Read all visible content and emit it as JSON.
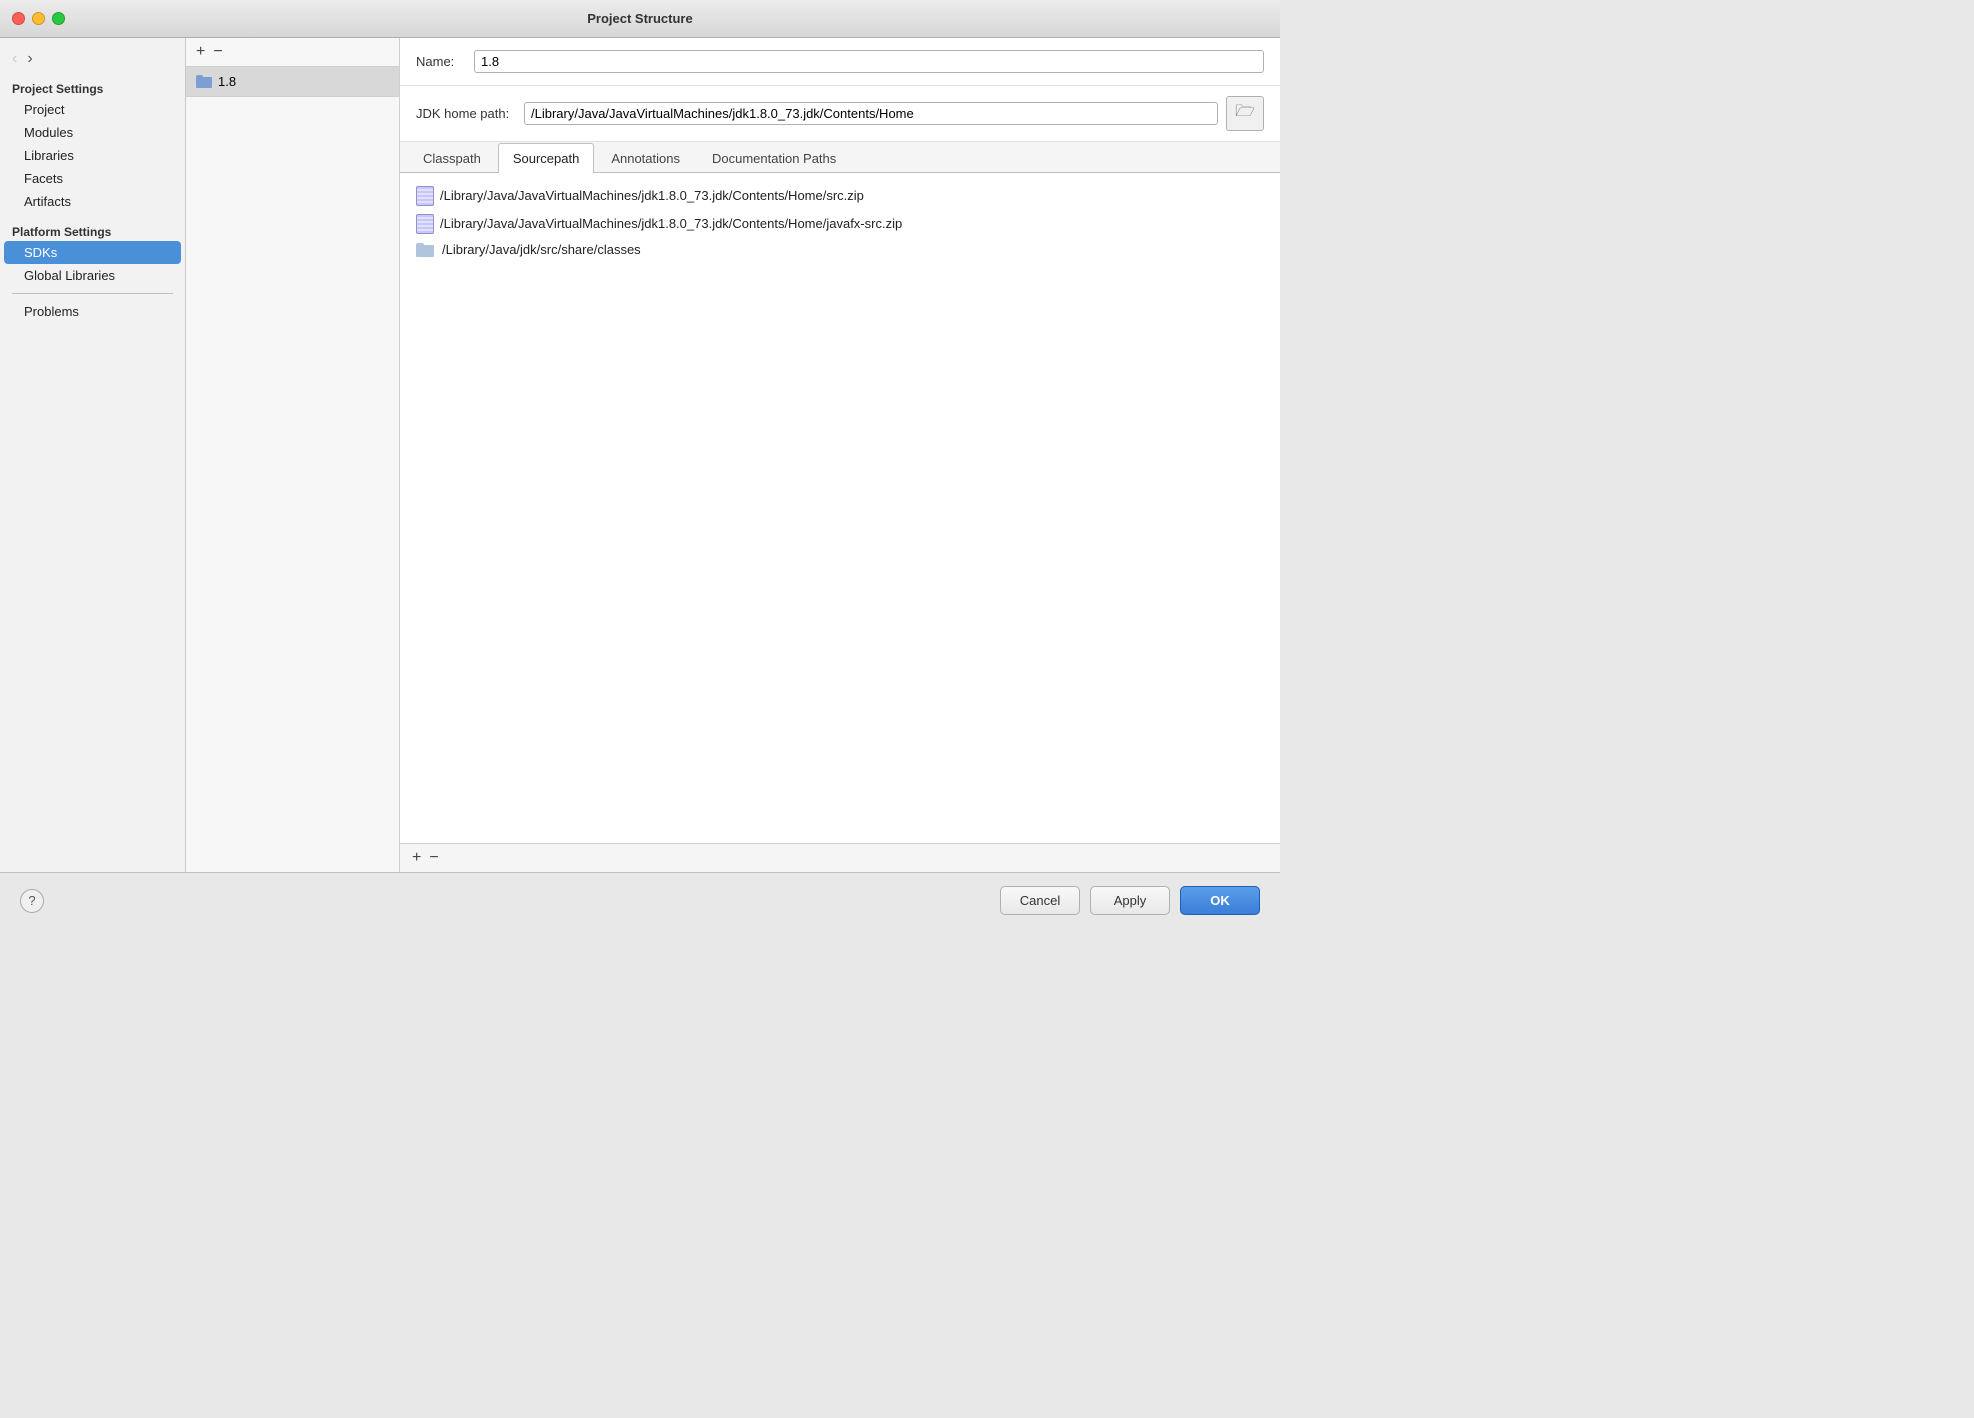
{
  "window": {
    "title": "Project Structure",
    "traffic_lights": [
      "close",
      "minimize",
      "maximize"
    ]
  },
  "sidebar": {
    "nav": {
      "back_label": "‹",
      "forward_label": "›"
    },
    "project_settings": {
      "header": "Project Settings",
      "items": [
        {
          "id": "project",
          "label": "Project"
        },
        {
          "id": "modules",
          "label": "Modules"
        },
        {
          "id": "libraries",
          "label": "Libraries"
        },
        {
          "id": "facets",
          "label": "Facets"
        },
        {
          "id": "artifacts",
          "label": "Artifacts"
        }
      ]
    },
    "platform_settings": {
      "header": "Platform Settings",
      "items": [
        {
          "id": "sdks",
          "label": "SDKs",
          "active": true
        },
        {
          "id": "global-libraries",
          "label": "Global Libraries"
        }
      ]
    },
    "other": {
      "items": [
        {
          "id": "problems",
          "label": "Problems"
        }
      ]
    }
  },
  "sdk_list": {
    "add_btn": "+",
    "remove_btn": "−",
    "items": [
      {
        "id": "1.8",
        "label": "1.8",
        "selected": true
      }
    ],
    "bottom_add": "+",
    "bottom_remove": "−"
  },
  "detail": {
    "name_label": "Name:",
    "name_value": "1.8",
    "jdk_path_label": "JDK home path:",
    "jdk_path_value": "/Library/Java/JavaVirtualMachines/jdk1.8.0_73.jdk/Contents/Home",
    "tabs": [
      {
        "id": "classpath",
        "label": "Classpath"
      },
      {
        "id": "sourcepath",
        "label": "Sourcepath",
        "active": true
      },
      {
        "id": "annotations",
        "label": "Annotations"
      },
      {
        "id": "documentation-paths",
        "label": "Documentation Paths"
      }
    ],
    "paths": [
      {
        "type": "zip",
        "path": "/Library/Java/JavaVirtualMachines/jdk1.8.0_73.jdk/Contents/Home/src.zip"
      },
      {
        "type": "zip",
        "path": "/Library/Java/JavaVirtualMachines/jdk1.8.0_73.jdk/Contents/Home/javafx-src.zip"
      },
      {
        "type": "folder",
        "path": "/Library/Java/jdk/src/share/classes"
      }
    ],
    "path_toolbar": {
      "add_btn": "+",
      "remove_btn": "−"
    }
  },
  "footer": {
    "help_btn": "?",
    "cancel_btn": "Cancel",
    "apply_btn": "Apply",
    "ok_btn": "OK"
  }
}
